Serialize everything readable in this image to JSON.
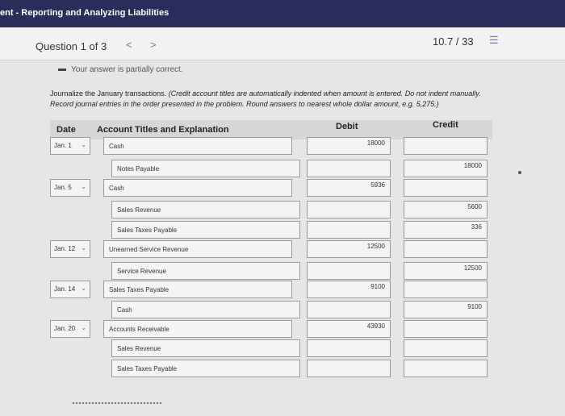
{
  "header": {
    "title": "ent - Reporting and Analyzing Liabilities"
  },
  "question": {
    "label": "Question 1 of 3",
    "prev": "<",
    "next": ">",
    "score": "10.7 / 33",
    "list_icon": "list-icon"
  },
  "feedback": {
    "status": "Your answer is partially correct."
  },
  "instructions": {
    "plain": "Journalize the January transactions. ",
    "italic": "(Credit account titles are automatically indented when amount is entered. Do not indent manually. Record journal entries in the order presented in the problem. Round answers to nearest whole dollar amount, e.g. 5,275.)"
  },
  "table": {
    "headers": {
      "date": "Date",
      "account": "Account Titles and Explanation",
      "debit": "Debit",
      "credit": "Credit"
    },
    "rows": [
      {
        "date": "Jan. 1",
        "account": "Cash",
        "debit": "18000",
        "credit": ""
      },
      {
        "date": "",
        "account": "Notes Payable",
        "debit": "",
        "credit": "18000"
      },
      {
        "date": "Jan. 5",
        "account": "Cash",
        "debit": "5936",
        "credit": ""
      },
      {
        "date": "",
        "account": "Sales Revenue",
        "debit": "",
        "credit": "5600"
      },
      {
        "date": "",
        "account": "Sales Taxes Payable",
        "debit": "",
        "credit": "336"
      },
      {
        "date": "Jan. 12",
        "account": "Unearned Service Revenue",
        "debit": "12500",
        "credit": ""
      },
      {
        "date": "",
        "account": "Service Revenue",
        "debit": "",
        "credit": "12500"
      },
      {
        "date": "Jan. 14",
        "account": "Sales Taxes Payable",
        "debit": "9100",
        "credit": ""
      },
      {
        "date": "",
        "account": "Cash",
        "debit": "",
        "credit": "9100"
      },
      {
        "date": "Jan. 20",
        "account": "Accounts Receivable",
        "debit": "43930",
        "credit": ""
      },
      {
        "date": "",
        "account": "Sales Revenue",
        "debit": "",
        "credit": ""
      },
      {
        "date": "",
        "account": "Sales Taxes Payable",
        "debit": "",
        "credit": ""
      }
    ]
  }
}
